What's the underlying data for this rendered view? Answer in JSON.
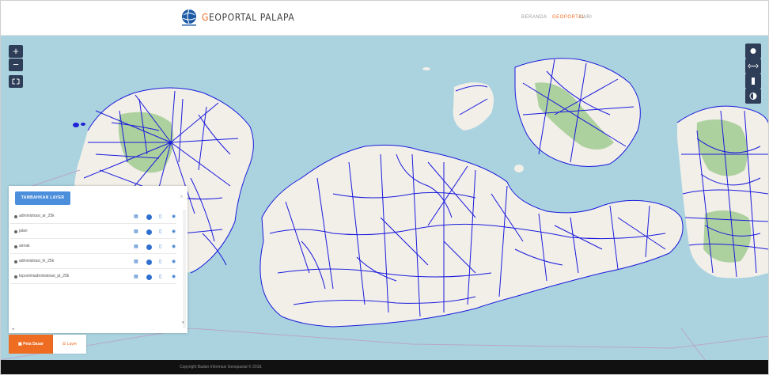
{
  "header": {
    "logo_icon": "globe-icon",
    "brand_first_letter": "G",
    "brand_rest": "EOPORTAL PALAPA",
    "accent_color": "#ef6d22",
    "nav": [
      {
        "label": "BERANDA"
      },
      {
        "label": "GEOPORTAL"
      },
      {
        "label": "CARI"
      }
    ]
  },
  "map": {
    "controls": {
      "zoom_in": "+",
      "zoom_out": "−",
      "fullscreen_icon": "fullscreen-icon",
      "right_tools": [
        "circle-tool-icon",
        "measure-icon",
        "bookmark-icon",
        "contrast-icon"
      ]
    },
    "colors": {
      "sea": "#aad3df",
      "land": "#f2efe9",
      "forest": "#add19e",
      "roads": "#1a1adc"
    }
  },
  "layer_panel": {
    "add_button": "TAMBAHKAN LAYER",
    "close_icon": "close-icon",
    "layers": [
      {
        "name": "administrasi_ar_25k"
      },
      {
        "name": "jalan"
      },
      {
        "name": "airnak"
      },
      {
        "name": "administrasi_ln_25k"
      },
      {
        "name": "toponimiadministrasi_pt_25k"
      }
    ],
    "row_icons": [
      "grid-icon",
      "color-dot-icon",
      "trash-icon",
      "eye-icon"
    ]
  },
  "bottom_buttons": {
    "peta_dasar": "Peta Dasar",
    "layer": "Layer"
  },
  "footer": {
    "copyright": "Copyright Badan Informasi Geospasial © 2018."
  }
}
